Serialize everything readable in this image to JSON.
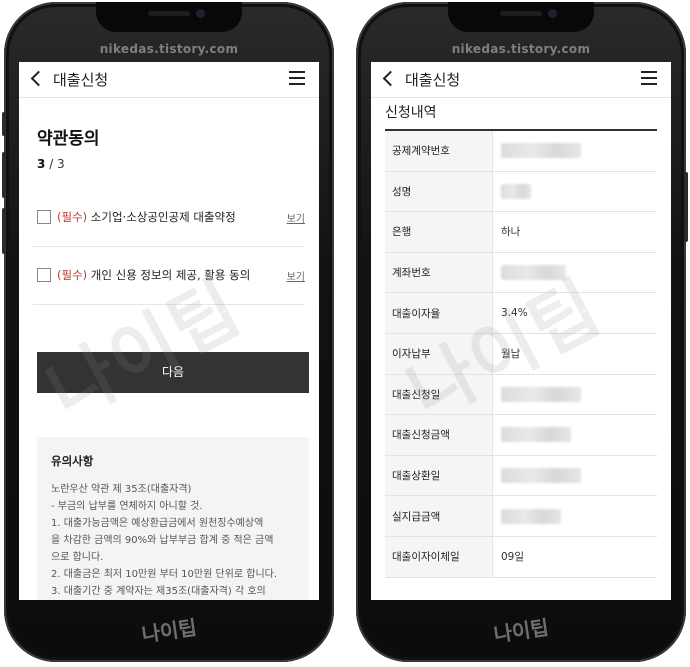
{
  "watermark": {
    "site": "nikedas.tistory.com",
    "brand": "나이팁"
  },
  "left": {
    "header": {
      "title": "대출신청"
    },
    "page_title": "약관동의",
    "step": {
      "current": "3",
      "total": "/ 3"
    },
    "terms": [
      {
        "required_tag": "(필수)",
        "label": "소기업·소상공인공제 대출약정",
        "view": "보기"
      },
      {
        "required_tag": "(필수)",
        "label": "개인 신용 정보의 제공, 활용 동의",
        "view": "보기"
      }
    ],
    "next_button": "다음",
    "notice": {
      "title": "유의사항",
      "lines": [
        "노란우산 약관 제 35조(대출자격)",
        "- 부금의 납부를 연체하지 아니할 것.",
        "1. 대출가능금액은 예상환급금에서 원천징수예상액",
        "을 차감한 금액의 90%와 납부부금 합계 중 적은 금액",
        "으로 합니다.",
        "2. 대출금은 최저 10만원 부터 10만원 단위로 합니다.",
        "3. 대출기간 중 계약자는 제35조(대출자격) 각 호의"
      ]
    }
  },
  "right": {
    "header": {
      "title": "대출신청"
    },
    "section_title": "신청내역",
    "rows": [
      {
        "label": "공제계약번호",
        "value": "",
        "masked": true
      },
      {
        "label": "성명",
        "value": "",
        "masked": true
      },
      {
        "label": "은행",
        "value": "하나",
        "masked": false
      },
      {
        "label": "계좌번호",
        "value": "",
        "masked": true
      },
      {
        "label": "대출이자율",
        "value": "3.4%",
        "masked": false
      },
      {
        "label": "이자납부",
        "value": "월납",
        "masked": false
      },
      {
        "label": "대출신청일",
        "value": "",
        "masked": true
      },
      {
        "label": "대출신청금액",
        "value": "",
        "masked": true
      },
      {
        "label": "대출상환일",
        "value": "",
        "masked": true
      },
      {
        "label": "실지급금액",
        "value": "",
        "masked": true
      },
      {
        "label": "대출이자이체일",
        "value": "09일",
        "masked": false
      }
    ]
  }
}
